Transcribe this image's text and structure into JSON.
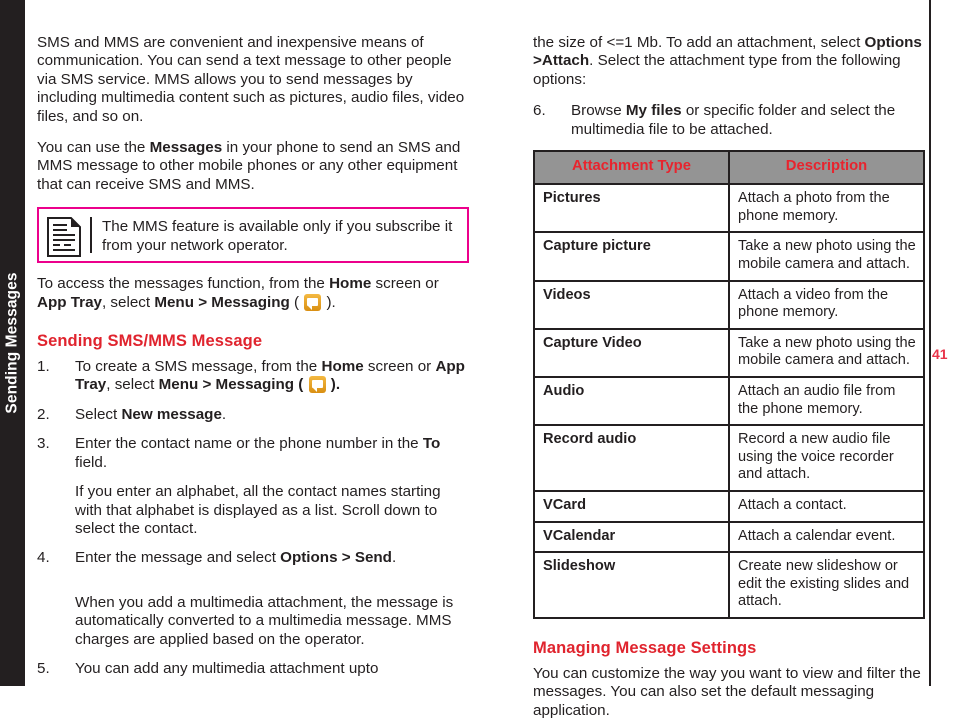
{
  "side_tab": {
    "label": "Sending Messages"
  },
  "page_number": "41",
  "left_column": {
    "intro_paragraph_1": "SMS and MMS are convenient and inexpensive means of communication. You can send a text message to other people via SMS service. MMS allows you to send messages by including multimedia content such as pictures, audio files, video files, and so on.",
    "intro_paragraph_2_part1": "You can use the ",
    "intro_paragraph_2_bold": "Messages",
    "intro_paragraph_2_part2": " in your phone to send an SMS and MMS message to other mobile phones or any other equipment that can receive SMS and MMS.",
    "note": {
      "icon_name": "document-note-icon",
      "text": "The MMS feature is available only if you subscribe it from your network operator."
    },
    "access_line": {
      "part1": "To access the messages function, from the ",
      "bold1": "Home",
      "part2": " screen or ",
      "bold2": "App Tray",
      "part3": ", select ",
      "bold3": "Menu > Messaging",
      "part4": " ( ",
      "icon_name": "messaging-app-icon",
      "part5": " )."
    },
    "section_heading": "Sending SMS/MMS Message",
    "steps": [
      {
        "num": "1.",
        "part1": "To create a SMS message, from the ",
        "bold1": "Home",
        "part2": " screen or ",
        "bold2": "App Tray",
        "part3": ", select ",
        "bold3": "Menu > Messaging",
        "part4": " ( ",
        "part5": " )."
      },
      {
        "num": "2.",
        "part1": "Select ",
        "bold1": "New message",
        "part2": "."
      },
      {
        "num": "3.",
        "part1": "Enter the contact name or the phone number in the ",
        "bold1": "To",
        "part2": " field.",
        "sub": "If you enter an alphabet, all the contact names starting with that alphabet is displayed as a list. Scroll down to select the contact."
      },
      {
        "num": "4.",
        "part1": "Enter the message and select ",
        "bold1": "Options > Send",
        "part2": ".",
        "sub": "When you add a multimedia attachment, the message is automatically converted to a multimedia message. MMS charges are applied based on the operator."
      },
      {
        "num": "5.",
        "part1": "You can add any multimedia attachment upto"
      }
    ]
  },
  "right_column": {
    "continuation": {
      "part1": "the size of <=1 Mb. To add an attachment, select ",
      "bold1": "Options >Attach",
      "part2": ". Select the attachment type from the following options:"
    },
    "step6": {
      "num": "6.",
      "part1": "Browse ",
      "bold1": "My files",
      "part2": " or specific folder and select the multimedia file to be attached."
    },
    "table": {
      "headers": [
        "Attachment Type",
        "Description"
      ],
      "rows": [
        {
          "type": "Pictures",
          "desc": "Attach a photo from the phone memory."
        },
        {
          "type": "Capture picture",
          "desc": "Take a new photo using the mobile camera and attach."
        },
        {
          "type": "Videos",
          "desc": "Attach a video from the phone memory."
        },
        {
          "type": "Capture Video",
          "desc": "Take a new photo using the mobile camera and attach."
        },
        {
          "type": "Audio",
          "desc": "Attach an audio file from the phone memory."
        },
        {
          "type": "Record audio",
          "desc": "Record a new audio file using the voice recorder and attach."
        },
        {
          "type": "VCard",
          "desc": "Attach a contact."
        },
        {
          "type": "VCalendar",
          "desc": "Attach a calendar event."
        },
        {
          "type": "Slideshow",
          "desc": "Create new slideshow or edit the existing slides and attach."
        }
      ]
    },
    "section_heading": "Managing Message Settings",
    "closing_paragraph": "You can customize the way you want to view and filter the messages. You can also set the default messaging application."
  },
  "colors": {
    "heading_red": "#E0242E",
    "note_border_pink": "#EC008C",
    "table_header_bg": "#949494",
    "table_header_text": "#E8242E",
    "tab_black": "#231F20",
    "page_number_red": "#E8344A"
  }
}
